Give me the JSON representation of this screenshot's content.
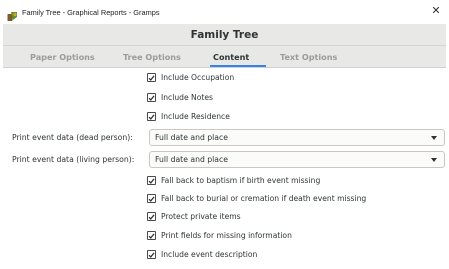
{
  "window": {
    "title": "Family Tree - Graphical Reports - Gramps",
    "close_icon": "close-icon"
  },
  "header": {
    "title": "Family Tree"
  },
  "tabs": [
    {
      "label": "Paper Options",
      "active": false
    },
    {
      "label": "Tree Options",
      "active": false
    },
    {
      "label": "Content",
      "active": true
    },
    {
      "label": "Text Options",
      "active": false
    }
  ],
  "options": {
    "include_occupation": {
      "label": "Include Occupation",
      "checked": true
    },
    "include_notes": {
      "label": "Include Notes",
      "checked": true
    },
    "include_residence": {
      "label": "Include Residence",
      "checked": true
    },
    "dead_person": {
      "label": "Print event data (dead person):",
      "value": "Full date and place"
    },
    "living_person": {
      "label": "Print event data (living person):",
      "value": "Full date and place"
    },
    "baptism_fallback": {
      "label": "Fall back to baptism if birth event missing",
      "checked": true
    },
    "burial_fallback": {
      "label": "Fall back to burial or cremation if death event missing",
      "checked": true
    },
    "protect_private": {
      "label": "Protect private items",
      "checked": true
    },
    "missing_info": {
      "label": "Print fields for missing information",
      "checked": true
    },
    "event_description": {
      "label": "Include event description",
      "checked": true
    }
  },
  "colors": {
    "accent": "#3584e4",
    "header_bg": "#e8e8e7",
    "inactive_tab": "#9a9c98",
    "text": "#2e3436"
  }
}
